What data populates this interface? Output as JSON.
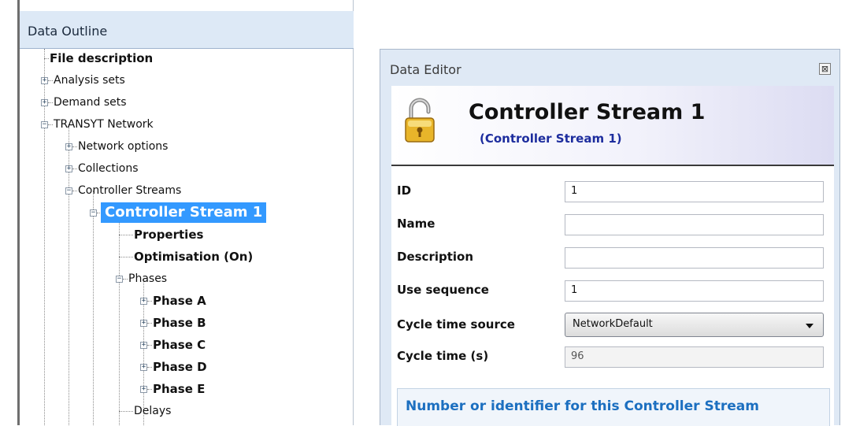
{
  "outline": {
    "title": "Data Outline",
    "nodes": {
      "file_description": "File description",
      "analysis_sets": "Analysis sets",
      "demand_sets": "Demand sets",
      "transyt_network": "TRANSYT Network",
      "network_options": "Network options",
      "collections": "Collections",
      "controller_streams": "Controller Streams",
      "controller_stream_1": "Controller Stream 1",
      "properties": "Properties",
      "optimisation": "Optimisation (On)",
      "phases": "Phases",
      "phase_a": "Phase A",
      "phase_b": "Phase B",
      "phase_c": "Phase C",
      "phase_d": "Phase D",
      "phase_e": "Phase E",
      "delays": "Delays"
    },
    "selected": "controller_stream_1"
  },
  "editor": {
    "title": "Data Editor",
    "close_symbol": "⊠",
    "header_title": "Controller Stream 1",
    "header_subtitle": "(Controller Stream 1)",
    "lock_icon": "unlocked-padlock-icon",
    "fields": {
      "id": {
        "label": "ID",
        "value": "1"
      },
      "name": {
        "label": "Name",
        "value": ""
      },
      "description": {
        "label": "Description",
        "value": ""
      },
      "use_sequence": {
        "label": "Use sequence",
        "value": "1"
      },
      "cycle_time_source": {
        "label": "Cycle time source",
        "value": "NetworkDefault"
      },
      "cycle_time": {
        "label": "Cycle time (s)",
        "value": "96"
      }
    },
    "help_text": "Number or identifier for this Controller Stream"
  },
  "colors": {
    "selection": "#3399ff",
    "panel_title_bg": "#dde9f6",
    "help_text": "#1c6fc0",
    "subtitle": "#1d2d9e"
  }
}
